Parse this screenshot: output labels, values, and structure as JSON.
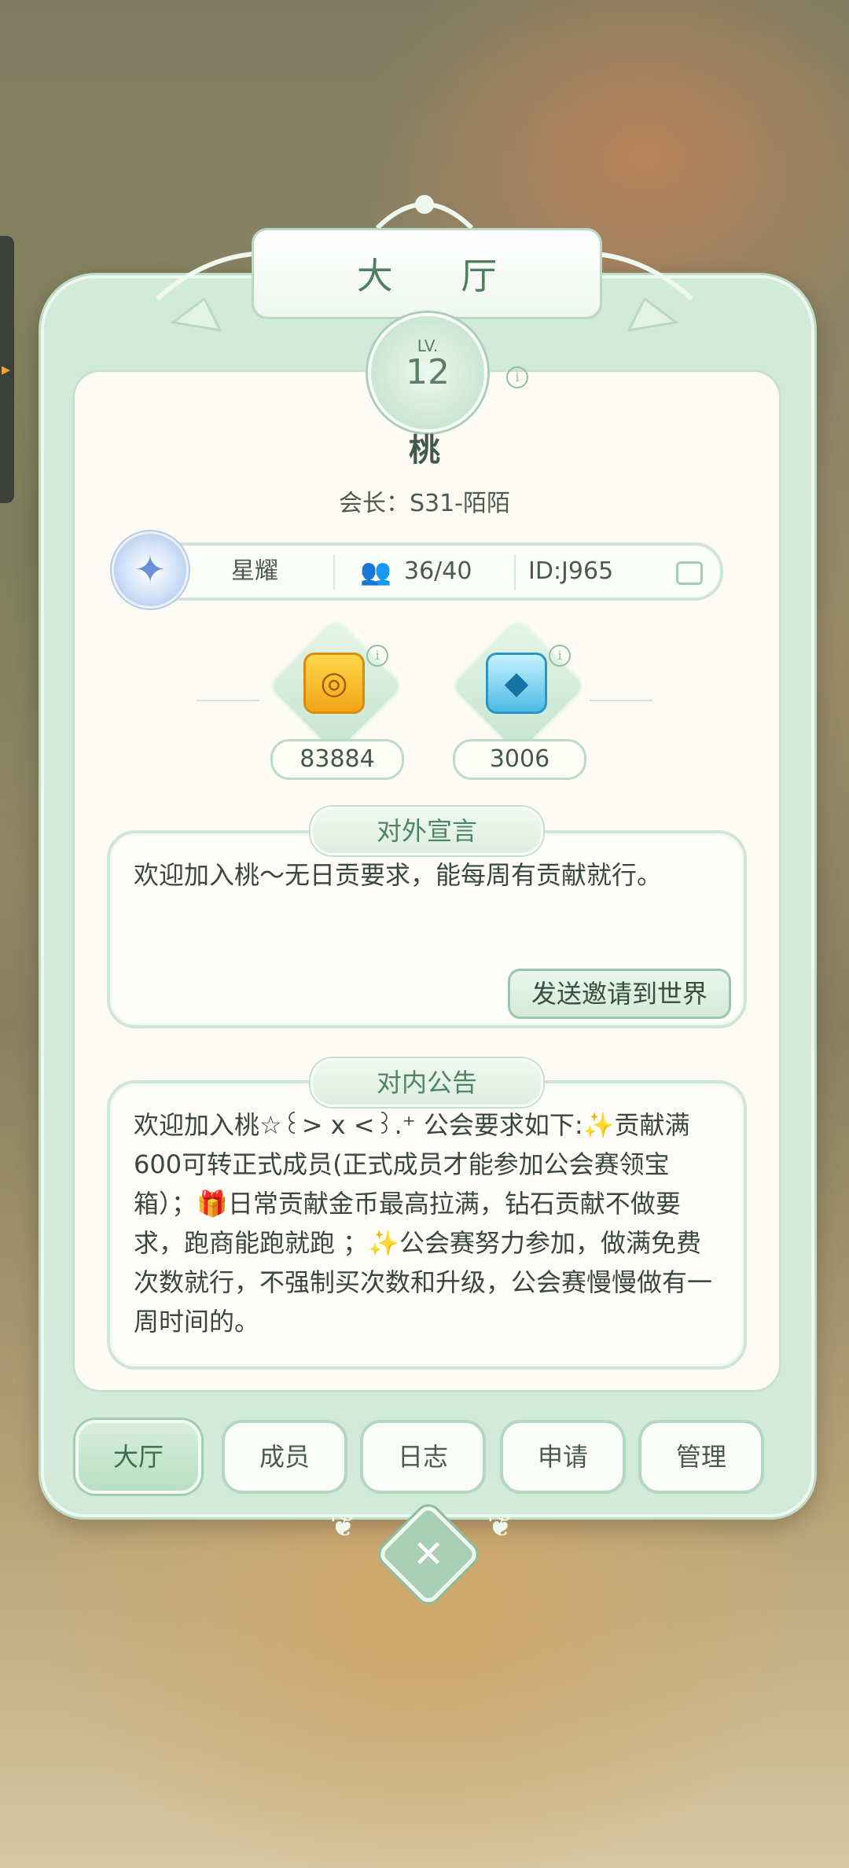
{
  "window": {
    "title": "大 厅"
  },
  "guild": {
    "level_label": "LV.",
    "level": "12",
    "name": "桃",
    "leader": "会长：S31-陌陌",
    "rank": "星耀",
    "members": "36/40",
    "id": "ID:J965"
  },
  "resources": [
    {
      "icon": "coin-icon",
      "value": "83884"
    },
    {
      "icon": "gem-icon",
      "value": "3006"
    }
  ],
  "external": {
    "title": "对外宣言",
    "text": "欢迎加入桃～无日贡要求，能每周有贡献就行。",
    "button": "发送邀请到世界"
  },
  "internal": {
    "title": "对内公告",
    "text": "欢迎加入桃☆꒰> x <꒱.⁺ 公会要求如下:✨贡献满600可转正式成员(正式成员才能参加公会赛领宝箱）；🎁日常贡献金币最高拉满，钻石贡献不做要求，跑商能跑就跑 ；✨公会赛努力参加，做满免费次数就行，不强制买次数和升级，公会赛慢慢做有一周时间的。"
  },
  "tabs": [
    {
      "label": "大厅",
      "active": true
    },
    {
      "label": "成员",
      "active": false
    },
    {
      "label": "日志",
      "active": false
    },
    {
      "label": "申请",
      "active": false
    },
    {
      "label": "管理",
      "active": false
    }
  ],
  "colors": {
    "accent": "#4e7f5f",
    "panel": "#d2ead9",
    "coin": "#f2a515",
    "gem": "#4dbbe6"
  }
}
